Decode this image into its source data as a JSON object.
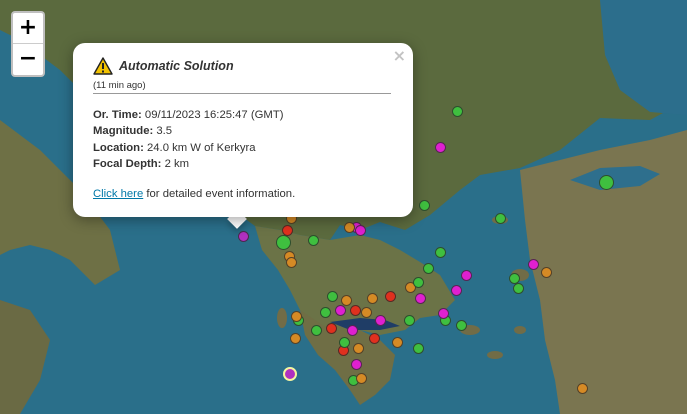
{
  "map": {
    "zoom_in_label": "+",
    "zoom_out_label": "−",
    "marker_colors": {
      "green": "#3fbf3f",
      "orange": "#d58a25",
      "red": "#e0301e",
      "magenta": "#e020d0",
      "purple": "#b030c0"
    },
    "markers": [
      {
        "color": "green",
        "size": "small"
      },
      {
        "color": "magenta",
        "size": "small"
      },
      {
        "color": "green",
        "size": "large"
      },
      {
        "color": "green",
        "size": "small"
      },
      {
        "color": "green",
        "size": "small"
      },
      {
        "color": "purple",
        "size": "small"
      },
      {
        "color": "green",
        "size": "large"
      },
      {
        "color": "orange",
        "size": "small"
      },
      {
        "color": "red",
        "size": "small"
      },
      {
        "color": "magenta",
        "size": "small"
      },
      {
        "color": "orange",
        "size": "small"
      },
      {
        "color": "magenta",
        "size": "small"
      },
      {
        "color": "green",
        "size": "small"
      },
      {
        "color": "orange",
        "size": "small"
      },
      {
        "color": "orange",
        "size": "small"
      },
      {
        "color": "magenta",
        "size": "small"
      },
      {
        "color": "green",
        "size": "small"
      },
      {
        "color": "green",
        "size": "small"
      },
      {
        "color": "green",
        "size": "small"
      },
      {
        "color": "magenta",
        "size": "small"
      },
      {
        "color": "orange",
        "size": "small"
      },
      {
        "color": "red",
        "size": "small"
      },
      {
        "color": "orange",
        "size": "small"
      },
      {
        "color": "magenta",
        "size": "small"
      },
      {
        "color": "red",
        "size": "small"
      },
      {
        "color": "green",
        "size": "small"
      },
      {
        "color": "orange",
        "size": "small"
      },
      {
        "color": "magenta",
        "size": "small"
      },
      {
        "color": "red",
        "size": "small"
      },
      {
        "color": "green",
        "size": "small"
      },
      {
        "color": "orange",
        "size": "small"
      },
      {
        "color": "green",
        "size": "small"
      },
      {
        "color": "magenta",
        "size": "small"
      },
      {
        "color": "green",
        "size": "small"
      },
      {
        "color": "green",
        "size": "small"
      },
      {
        "color": "orange",
        "size": "small"
      },
      {
        "color": "red",
        "size": "small"
      },
      {
        "color": "orange",
        "size": "small"
      },
      {
        "color": "magenta",
        "size": "small"
      },
      {
        "color": "magenta",
        "size": "small"
      },
      {
        "color": "green",
        "size": "small"
      },
      {
        "color": "orange",
        "size": "small"
      },
      {
        "color": "purple",
        "size": "medium"
      },
      {
        "color": "green",
        "size": "small"
      },
      {
        "color": "orange",
        "size": "small"
      },
      {
        "color": "magenta",
        "size": "small"
      },
      {
        "color": "green",
        "size": "small"
      },
      {
        "color": "orange",
        "size": "small"
      },
      {
        "color": "green",
        "size": "small"
      },
      {
        "color": "orange",
        "size": "small"
      },
      {
        "color": "red",
        "size": "small"
      },
      {
        "color": "orange",
        "size": "small"
      },
      {
        "color": "green",
        "size": "small"
      },
      {
        "color": "green",
        "size": "small"
      },
      {
        "color": "magenta",
        "size": "small"
      },
      {
        "color": "green",
        "size": "small"
      }
    ]
  },
  "popup": {
    "title": "Automatic Solution",
    "ago": "(11 min ago)",
    "close_label": "×",
    "warning_icon": "warning-triangle-icon",
    "rows": [
      {
        "label": "Or. Time:",
        "value": "09/11/2023 16:25:47 (GMT)"
      },
      {
        "label": "Magnitude:",
        "value": "3.5"
      },
      {
        "label": "Location:",
        "value": "24.0 km W of Kerkyra"
      },
      {
        "label": "Focal Depth:",
        "value": "2 km"
      }
    ],
    "link_text": "Click here",
    "link_suffix": " for detailed event information."
  }
}
